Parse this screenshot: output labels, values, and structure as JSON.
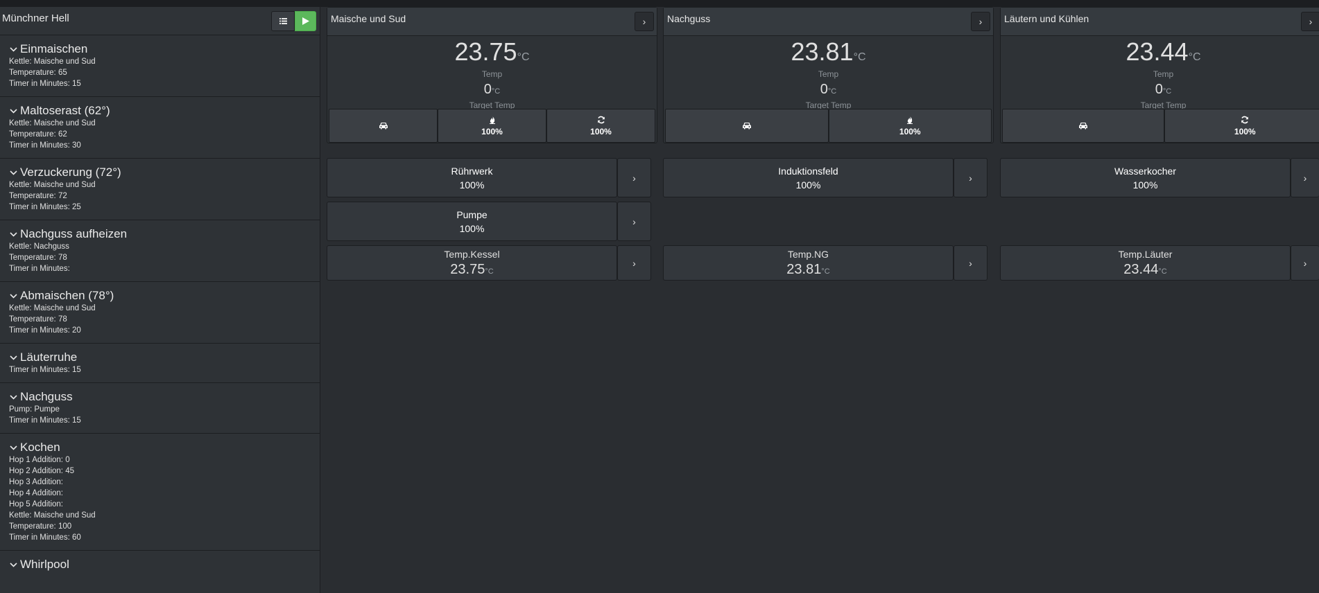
{
  "recipe": {
    "title": "Münchner Hell",
    "list_icon": "list-icon",
    "play_icon": "play-icon"
  },
  "steps": [
    {
      "title": "Einmaischen",
      "lines": [
        "Kettle: Maische und Sud",
        "Temperature: 65",
        "Timer in Minutes: 15"
      ]
    },
    {
      "title": "Maltoserast (62°)",
      "lines": [
        "Kettle: Maische und Sud",
        "Temperature: 62",
        "Timer in Minutes: 30"
      ]
    },
    {
      "title": "Verzuckerung (72°)",
      "lines": [
        "Kettle: Maische und Sud",
        "Temperature: 72",
        "Timer in Minutes: 25"
      ]
    },
    {
      "title": "Nachguss aufheizen",
      "lines": [
        "Kettle: Nachguss",
        "Temperature: 78",
        "Timer in Minutes:"
      ]
    },
    {
      "title": "Abmaischen (78°)",
      "lines": [
        "Kettle: Maische und Sud",
        "Temperature: 78",
        "Timer in Minutes: 20"
      ]
    },
    {
      "title": "Läuterruhe",
      "lines": [
        "Timer in Minutes: 15"
      ]
    },
    {
      "title": "Nachguss",
      "lines": [
        "Pump: Pumpe",
        "Timer in Minutes: 15"
      ]
    },
    {
      "title": "Kochen",
      "lines": [
        "Hop 1 Addition: 0",
        "Hop 2 Addition: 45",
        "Hop 3 Addition:",
        "Hop 4 Addition:",
        "Hop 5 Addition:",
        "Kettle: Maische und Sud",
        "Temperature: 100",
        "Timer in Minutes: 60"
      ]
    },
    {
      "title": "Whirlpool",
      "lines": []
    }
  ],
  "kettles": [
    {
      "name": "Maische und Sud",
      "temp": "23.75",
      "unit": "°C",
      "temp_label": "Temp",
      "target": "0",
      "target_label": "Target Temp",
      "buttons": [
        {
          "icon": "car-icon",
          "value": ""
        },
        {
          "icon": "fire-icon",
          "value": "100%"
        },
        {
          "icon": "refresh-icon",
          "value": "100%"
        }
      ]
    },
    {
      "name": "Nachguss",
      "temp": "23.81",
      "unit": "°C",
      "temp_label": "Temp",
      "target": "0",
      "target_label": "Target Temp",
      "buttons": [
        {
          "icon": "car-icon",
          "value": ""
        },
        {
          "icon": "fire-icon",
          "value": "100%"
        }
      ]
    },
    {
      "name": "Läutern und Kühlen",
      "temp": "23.44",
      "unit": "°C",
      "temp_label": "Temp",
      "target": "0",
      "target_label": "Target Temp",
      "buttons": [
        {
          "icon": "car-icon",
          "value": ""
        },
        {
          "icon": "refresh-icon",
          "value": "100%"
        }
      ]
    }
  ],
  "actors": [
    {
      "name": "Rührwerk",
      "value": "100%"
    },
    {
      "name": "Induktionsfeld",
      "value": "100%"
    },
    {
      "name": "Wasserkocher",
      "value": "100%"
    },
    {
      "name": "Pumpe",
      "value": "100%"
    }
  ],
  "sensors": [
    {
      "name": "Temp.Kessel",
      "value": "23.75",
      "unit": "°C"
    },
    {
      "name": "Temp.NG",
      "value": "23.81",
      "unit": "°C"
    },
    {
      "name": "Temp.Läuter",
      "value": "23.44",
      "unit": "°C"
    }
  ],
  "arrow_glyph": "›"
}
